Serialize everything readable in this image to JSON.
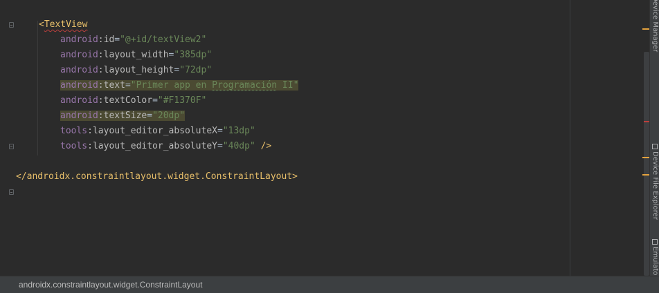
{
  "editor": {
    "lines": [
      {
        "indent": 56,
        "tokens": [
          {
            "t": "<",
            "c": "tag"
          },
          {
            "t": "TextView",
            "c": "tag squiggle"
          }
        ]
      },
      {
        "indent": 87,
        "tokens": [
          {
            "t": "android",
            "c": "attrns"
          },
          {
            "t": ":",
            "c": "attr"
          },
          {
            "t": "id",
            "c": "attr"
          },
          {
            "t": "=",
            "c": "plain"
          },
          {
            "t": "\"@+id/textView2\"",
            "c": "val"
          }
        ]
      },
      {
        "indent": 87,
        "tokens": [
          {
            "t": "android",
            "c": "attrns"
          },
          {
            "t": ":",
            "c": "attr"
          },
          {
            "t": "layout_width",
            "c": "attr"
          },
          {
            "t": "=",
            "c": "plain"
          },
          {
            "t": "\"385dp\"",
            "c": "val"
          }
        ]
      },
      {
        "indent": 87,
        "tokens": [
          {
            "t": "android",
            "c": "attrns"
          },
          {
            "t": ":",
            "c": "attr"
          },
          {
            "t": "layout_height",
            "c": "attr"
          },
          {
            "t": "=",
            "c": "plain"
          },
          {
            "t": "\"72dp\"",
            "c": "val"
          }
        ]
      },
      {
        "indent": 87,
        "highlight": true,
        "tokens": [
          {
            "t": "android",
            "c": "attrns"
          },
          {
            "t": ":",
            "c": "attr"
          },
          {
            "t": "text",
            "c": "attr"
          },
          {
            "t": "=",
            "c": "plain"
          },
          {
            "t": "\"Primer app en ",
            "c": "val"
          },
          {
            "t": "Programación",
            "c": "val underdot"
          },
          {
            "t": " II\"",
            "c": "val"
          }
        ]
      },
      {
        "indent": 87,
        "tokens": [
          {
            "t": "android",
            "c": "attrns"
          },
          {
            "t": ":",
            "c": "attr"
          },
          {
            "t": "textColor",
            "c": "attr"
          },
          {
            "t": "=",
            "c": "plain"
          },
          {
            "t": "\"#F1370F\"",
            "c": "val"
          }
        ]
      },
      {
        "indent": 87,
        "highlight": true,
        "tokens": [
          {
            "t": "android",
            "c": "attrns"
          },
          {
            "t": ":",
            "c": "attr"
          },
          {
            "t": "textSize",
            "c": "attr"
          },
          {
            "t": "=",
            "c": "plain"
          },
          {
            "t": "\"20dp\"",
            "c": "val"
          }
        ]
      },
      {
        "indent": 87,
        "tokens": [
          {
            "t": "tools",
            "c": "attrns"
          },
          {
            "t": ":",
            "c": "attr"
          },
          {
            "t": "layout_editor_absoluteX",
            "c": "attr"
          },
          {
            "t": "=",
            "c": "plain"
          },
          {
            "t": "\"13dp\"",
            "c": "val"
          }
        ]
      },
      {
        "indent": 87,
        "tokens": [
          {
            "t": "tools",
            "c": "attrns"
          },
          {
            "t": ":",
            "c": "attr"
          },
          {
            "t": "layout_editor_absoluteY",
            "c": "attr"
          },
          {
            "t": "=",
            "c": "plain"
          },
          {
            "t": "\"40dp\"",
            "c": "val"
          },
          {
            "t": " />",
            "c": "tag"
          }
        ]
      },
      {
        "indent": 0,
        "tokens": []
      },
      {
        "indent": 23,
        "tokens": [
          {
            "t": "</androidx.constraintlayout.widget.ConstraintLayout>",
            "c": "tag"
          }
        ]
      }
    ]
  },
  "tool_window": {
    "device_manager": "Device Manager",
    "device_file_explorer": "Device File Explorer",
    "emulator": "Emulator"
  },
  "status_bar": {
    "breadcrumb": "androidx.constraintlayout.widget.ConstraintLayout"
  },
  "colors": {
    "background": "#2b2b2b",
    "tag": "#e8bf6a",
    "namespace": "#9876aa",
    "value": "#6a8759",
    "warning_mark": "#e5a33e",
    "error_mark": "#bc3f3c"
  }
}
